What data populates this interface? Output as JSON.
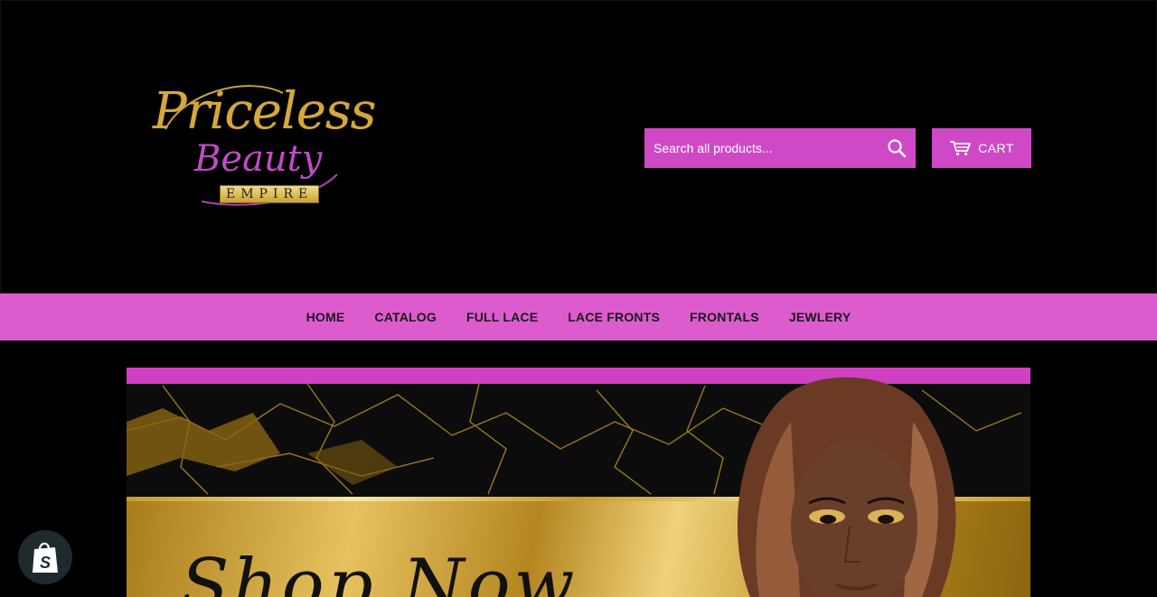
{
  "header": {
    "logo": {
      "line1": "Priceless",
      "line2": "Beauty",
      "line3": "EMPIRE"
    },
    "search": {
      "placeholder": "Search all products...",
      "icon": "search-icon"
    },
    "cart": {
      "label": "CART",
      "icon": "cart-icon"
    }
  },
  "nav": {
    "items": [
      {
        "label": "HOME"
      },
      {
        "label": "CATALOG"
      },
      {
        "label": "FULL LACE"
      },
      {
        "label": "LACE FRONTS"
      },
      {
        "label": "FRONTALS"
      },
      {
        "label": "JEWLERY"
      }
    ]
  },
  "hero": {
    "banner_text": "Shop Now"
  },
  "colors": {
    "accent": "#cf49c6",
    "nav_bg": "#dc5ccd",
    "background": "#000000",
    "gold": "#d4a83c"
  },
  "badge": {
    "icon": "shopify-bag-icon"
  }
}
